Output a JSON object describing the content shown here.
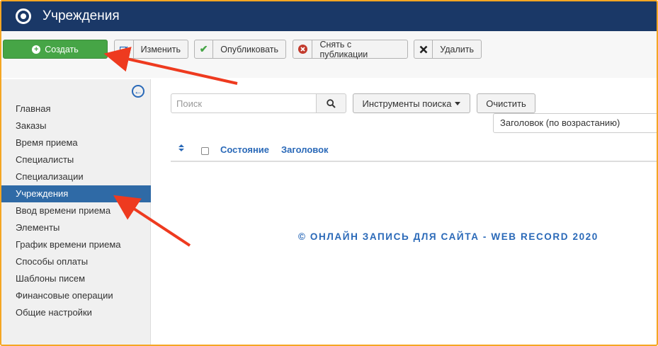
{
  "header": {
    "title": "Учреждения",
    "logo_icon": "joomla-logo-icon"
  },
  "toolbar": {
    "create_label": "Создать",
    "edit_label": "Изменить",
    "publish_label": "Опубликовать",
    "unpublish_label": "Снять с публикации",
    "delete_label": "Удалить"
  },
  "sidebar": {
    "toggle_icon": "collapse-left-icon",
    "items": [
      {
        "label": "Главная"
      },
      {
        "label": "Заказы"
      },
      {
        "label": "Время приема"
      },
      {
        "label": "Специалисты"
      },
      {
        "label": "Специализации"
      },
      {
        "label": "Учреждения",
        "active": true
      },
      {
        "label": "Ввод времени приема"
      },
      {
        "label": "Элементы"
      },
      {
        "label": "График времени приема"
      },
      {
        "label": "Способы оплаты"
      },
      {
        "label": "Шаблоны писем"
      },
      {
        "label": "Финансовые операции"
      },
      {
        "label": "Общие настройки"
      }
    ]
  },
  "search": {
    "placeholder": "Поиск",
    "tools_label": "Инструменты поиска",
    "clear_label": "Очистить",
    "sort_value": "Заголовок (по возрастанию)"
  },
  "table": {
    "columns": [
      "Состояние",
      "Заголовок"
    ]
  },
  "footer": {
    "copyright": "© ОНЛАЙН ЗАПИСЬ ДЛЯ САЙТА - WEB RECORD 2020"
  },
  "colors": {
    "header_bg": "#1a3867",
    "create_green": "#46a546",
    "active_blue": "#2f6aa6",
    "link_blue": "#2a69b8",
    "arrow_red": "#ee3a1f",
    "frame_orange": "#f5a623"
  }
}
